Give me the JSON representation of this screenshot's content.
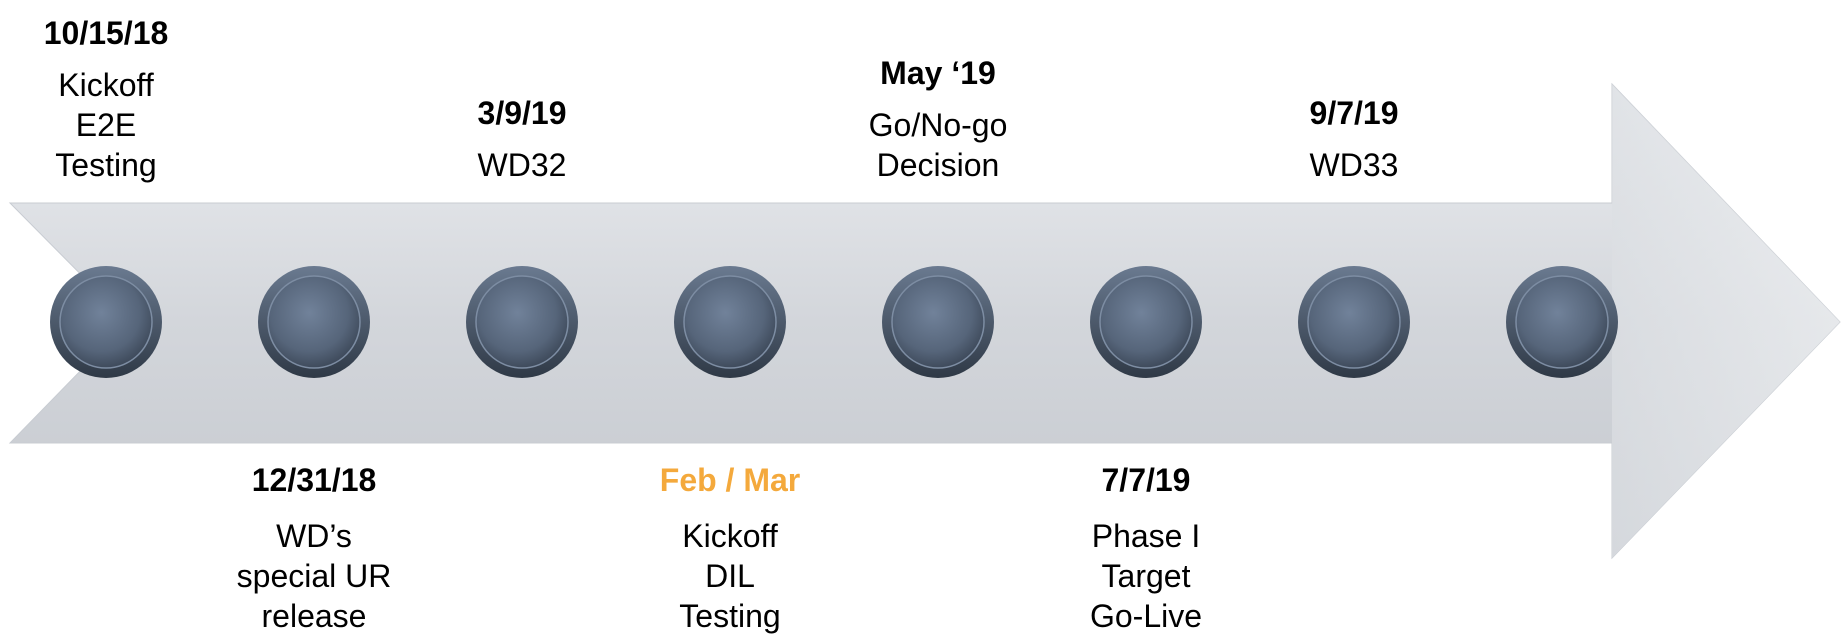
{
  "colors": {
    "arrow": "#d6d8dc",
    "node": "#5c6b80",
    "node_ring": "#3c4858",
    "highlight_date": "#f4a93c"
  },
  "milestones": [
    {
      "date": "10/15/18",
      "lines": [
        "Kickoff",
        "E2E",
        "Testing"
      ],
      "position": "above"
    },
    {
      "date": "12/31/18",
      "lines": [
        "WD’s",
        "special UR",
        "release"
      ],
      "position": "below"
    },
    {
      "date": "3/9/19",
      "lines": [
        "WD32"
      ],
      "position": "above"
    },
    {
      "date": "Feb / Mar",
      "lines": [
        "Kickoff",
        "DIL",
        "Testing"
      ],
      "position": "below",
      "highlight": true
    },
    {
      "date": "May ‘19",
      "lines": [
        "Go/No-go",
        "Decision"
      ],
      "position": "above"
    },
    {
      "date": "7/7/19",
      "lines": [
        "Phase I",
        "Target",
        "Go-Live"
      ],
      "position": "below"
    },
    {
      "date": "9/7/19",
      "lines": [
        "WD33"
      ],
      "position": "above"
    }
  ],
  "node_count": 8
}
